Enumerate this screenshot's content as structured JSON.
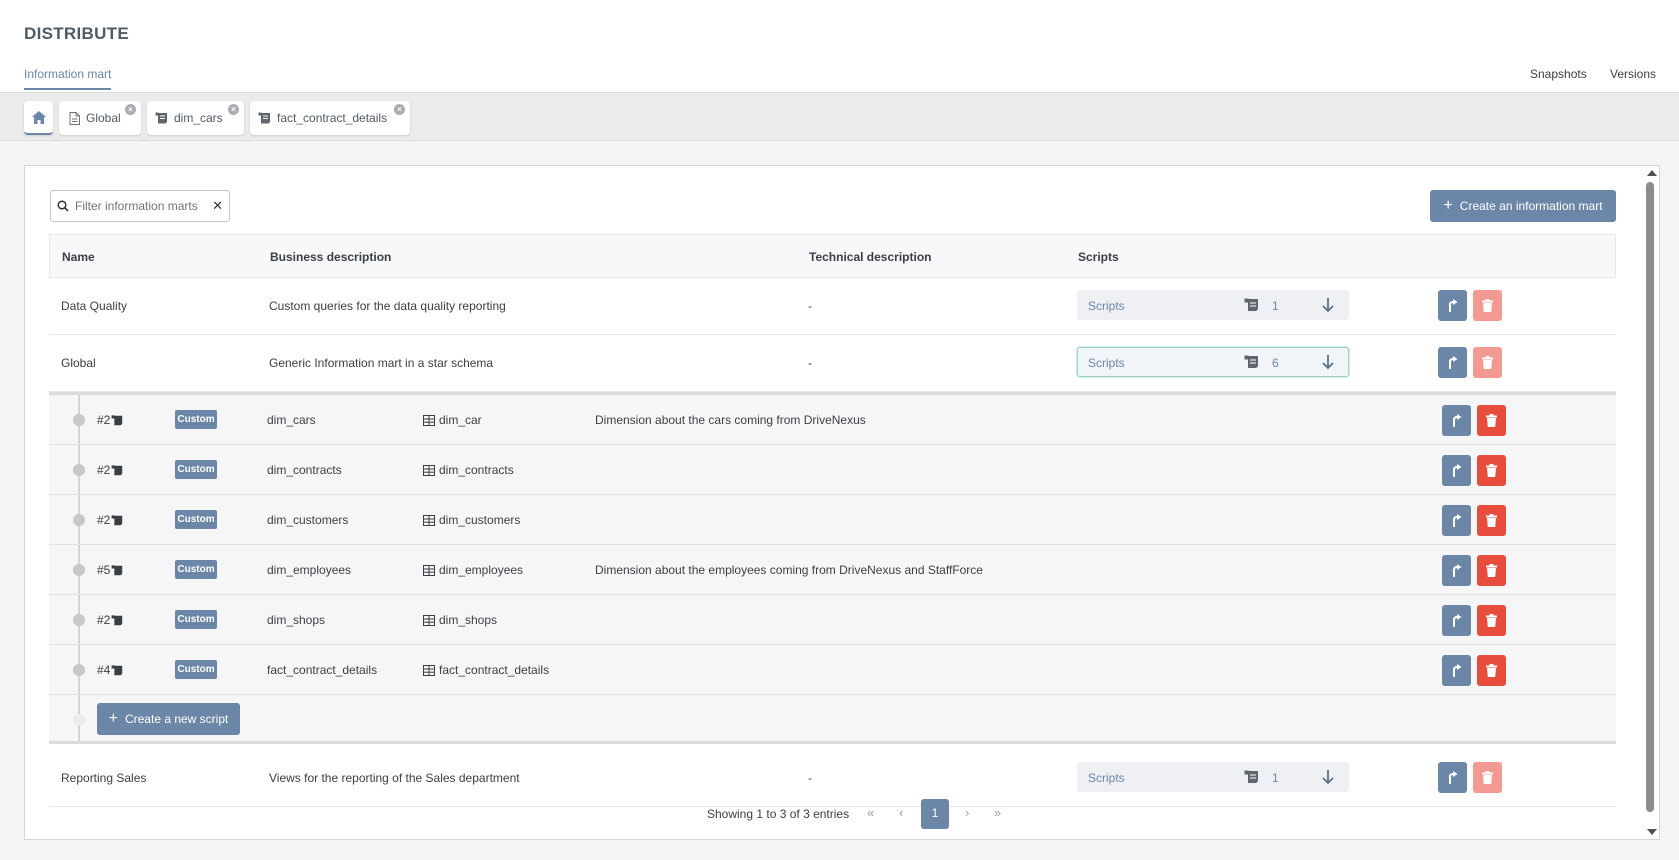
{
  "header": {
    "app_title": "DISTRIBUTE",
    "nav_active": "Information mart",
    "nav_right": [
      "Snapshots",
      "Versions"
    ]
  },
  "tabs": [
    {
      "label": "Global",
      "icon": "document-icon"
    },
    {
      "label": "dim_cars",
      "icon": "script-icon"
    },
    {
      "label": "fact_contract_details",
      "icon": "script-icon"
    }
  ],
  "search": {
    "placeholder": "Filter information marts",
    "value": ""
  },
  "create_mart_label": "Create an information mart",
  "columns": {
    "name": "Name",
    "business": "Business description",
    "technical": "Technical description",
    "scripts": "Scripts"
  },
  "marts": [
    {
      "name": "Data Quality",
      "business": "Custom queries for the data quality reporting",
      "technical": "-",
      "scripts_label": "Scripts",
      "count": "1"
    },
    {
      "name": "Global",
      "business": "Generic Information mart in a star schema",
      "technical": "-",
      "scripts_label": "Scripts",
      "count": "6"
    },
    {
      "name": "Reporting Sales",
      "business": "Views for the reporting of the Sales department",
      "technical": "-",
      "scripts_label": "Scripts",
      "count": "1"
    }
  ],
  "scripts": [
    {
      "num": "#2",
      "badge": "Custom",
      "name": "dim_cars",
      "target": "dim_car",
      "desc": "Dimension about the cars coming from DriveNexus"
    },
    {
      "num": "#2",
      "badge": "Custom",
      "name": "dim_contracts",
      "target": "dim_contracts",
      "desc": ""
    },
    {
      "num": "#2",
      "badge": "Custom",
      "name": "dim_customers",
      "target": "dim_customers",
      "desc": ""
    },
    {
      "num": "#5",
      "badge": "Custom",
      "name": "dim_employees",
      "target": "dim_employees",
      "desc": "Dimension about the employees coming from DriveNexus and StaffForce"
    },
    {
      "num": "#2",
      "badge": "Custom",
      "name": "dim_shops",
      "target": "dim_shops",
      "desc": ""
    },
    {
      "num": "#4",
      "badge": "Custom",
      "name": "fact_contract_details",
      "target": "fact_contract_details",
      "desc": ""
    }
  ],
  "create_script_label": "Create a new script",
  "pagination": {
    "info": "Showing 1 to 3 of 3 entries",
    "first": "«",
    "prev": "‹",
    "current": "1",
    "next": "›",
    "last": "»"
  },
  "colors": {
    "accent": "#6b86a6",
    "danger": "#e74c3c",
    "danger_light": "#f29a92"
  }
}
